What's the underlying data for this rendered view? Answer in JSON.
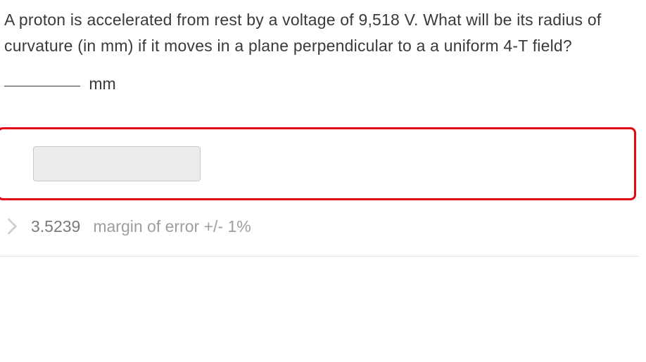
{
  "question": {
    "prompt": "A proton is accelerated from rest by a voltage of 9,518 V. What will be its radius of curvature (in mm) if it moves in a plane perpendicular to a a uniform 4-T field?",
    "unit_label": "mm"
  },
  "answer": {
    "input_value": "",
    "input_placeholder": ""
  },
  "result": {
    "correct_value": "3.5239",
    "margin_label": "margin of error +/- 1%"
  }
}
